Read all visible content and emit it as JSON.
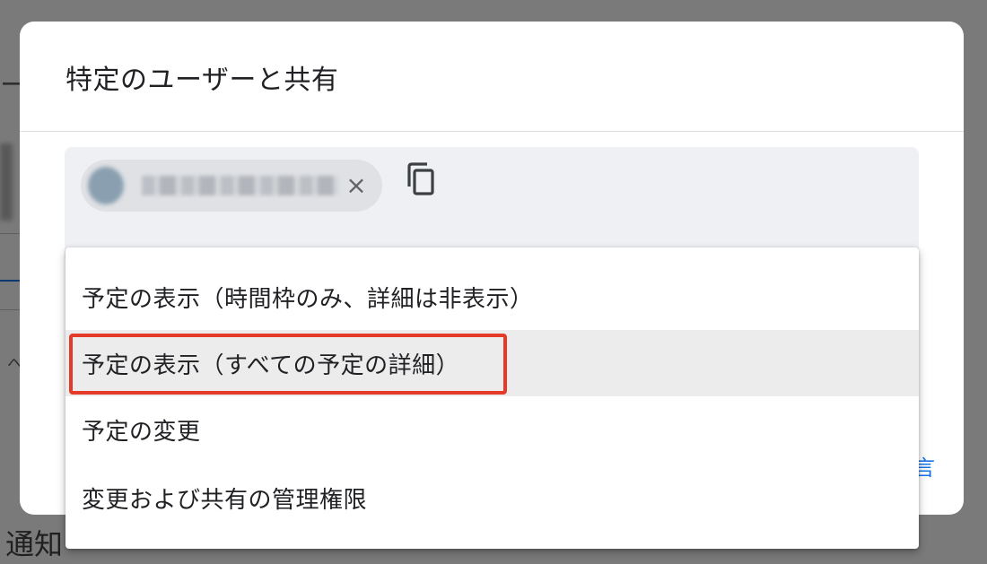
{
  "background": {
    "fragment_top": "ー",
    "fragment_mid": "へ",
    "notify_label": "通知",
    "right_hint": "言"
  },
  "dialog": {
    "title": "特定のユーザーと共有",
    "chip": {
      "remove_icon": "close-icon"
    },
    "copy_icon": "copy-icon"
  },
  "menu": {
    "items": [
      {
        "label": "予定の表示（時間枠のみ、詳細は非表示）",
        "selected": false
      },
      {
        "label": "予定の表示（すべての予定の詳細）",
        "selected": true
      },
      {
        "label": "予定の変更",
        "selected": false
      },
      {
        "label": "変更および共有の管理権限",
        "selected": false
      }
    ]
  },
  "colors": {
    "highlight": "#e53a2a",
    "accent": "#1a73e8"
  }
}
